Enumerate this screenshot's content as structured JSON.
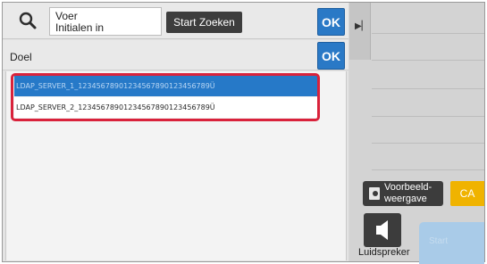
{
  "search": {
    "field_text": "Voer\nInitialen in",
    "start_label": "Start Zoeken",
    "ok_label": "OK"
  },
  "target": {
    "label": "Doel",
    "ok_label": "OK"
  },
  "servers": [
    {
      "name": "LDAP_SERVER_1_12345678901234567890123456789Ü",
      "selected": true
    },
    {
      "name": "LDAP_SERVER_2_12345678901234567890123456789Ü",
      "selected": false
    }
  ],
  "right_panel": {
    "preview_label": "Voorbeeld-\nweergave",
    "ca_label": "CA",
    "speaker_label": "Luidspreker",
    "start_label": "Start"
  },
  "colors": {
    "ok_blue": "#2a79c6",
    "selection_blue": "#2679c8",
    "highlight_red": "#d9223b",
    "ca_yellow": "#f0b300",
    "start_disabled": "#a9cbe8"
  }
}
